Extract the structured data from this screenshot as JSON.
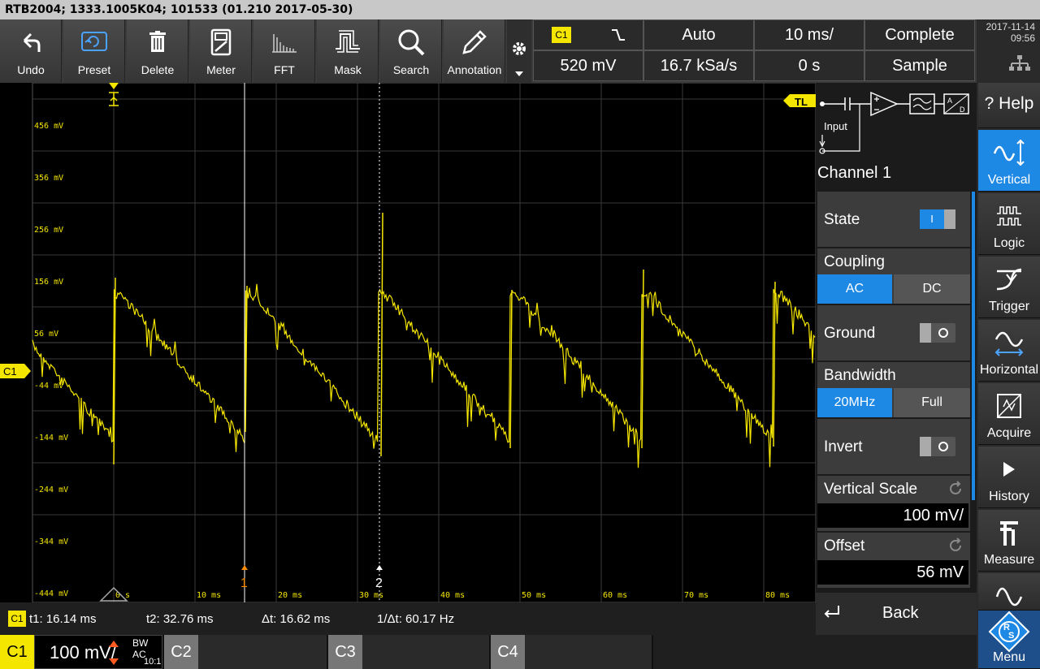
{
  "title": "RTB2004; 1333.1005K04; 101533 (01.210 2017-05-30)",
  "toolbar": [
    {
      "label": "Undo",
      "icon": "undo-icon"
    },
    {
      "label": "Preset",
      "icon": "preset-icon"
    },
    {
      "label": "Delete",
      "icon": "trash-icon"
    },
    {
      "label": "Meter",
      "icon": "meter-icon"
    },
    {
      "label": "FFT",
      "icon": "fft-icon"
    },
    {
      "label": "Mask",
      "icon": "mask-icon"
    },
    {
      "label": "Search",
      "icon": "search-icon"
    },
    {
      "label": "Annotation",
      "icon": "pencil-icon"
    }
  ],
  "status": {
    "trigger_source": "C1",
    "trigger_level": "520 mV",
    "trigger_mode": "Auto",
    "sample_rate": "16.7 kSa/s",
    "time_scale": "10 ms/",
    "time_offset": "0 s",
    "acq_state": "Complete",
    "acq_mode": "Sample"
  },
  "datetime": {
    "date": "2017-11-14",
    "time": "09:56"
  },
  "markers": {
    "trigger_level_label": "TL",
    "channel_label": "C1",
    "cursor1": "1",
    "cursor2": "2"
  },
  "y_ticks": [
    "456 mV",
    "356 mV",
    "256 mV",
    "156 mV",
    "56 mV",
    "-44 mV",
    "-144 mV",
    "-244 mV",
    "-344 mV",
    "-444 mV"
  ],
  "x_ticks": [
    "0 s",
    "10 ms",
    "20 ms",
    "30 ms",
    "40 ms",
    "50 ms",
    "60 ms",
    "70 ms",
    "80 ms"
  ],
  "cursors": {
    "channel": "C1",
    "t1": "t1: 16.14 ms",
    "t2": "t2: 32.76 ms",
    "dt": "Δt: 16.62 ms",
    "inv_dt": "1/Δt: 60.17 Hz"
  },
  "panel": {
    "block_input": "Input",
    "title": "Channel 1",
    "state_label": "State",
    "state_toggle": "I",
    "coupling_label": "Coupling",
    "coupling_ac": "AC",
    "coupling_dc": "DC",
    "ground_label": "Ground",
    "bandwidth_label": "Bandwidth",
    "bw_20": "20MHz",
    "bw_full": "Full",
    "invert_label": "Invert",
    "vscale_label": "Vertical Scale",
    "vscale_value": "100 mV/",
    "offset_label": "Offset",
    "offset_value": "56 mV",
    "back_label": "Back"
  },
  "sidebar": [
    {
      "label": "? Help",
      "icon": "help-icon"
    },
    {
      "label": "Vertical",
      "icon": "vertical-icon",
      "active": true
    },
    {
      "label": "Logic",
      "icon": "logic-icon"
    },
    {
      "label": "Trigger",
      "icon": "trigger-icon"
    },
    {
      "label": "Horizontal",
      "icon": "horizontal-icon"
    },
    {
      "label": "Acquire",
      "icon": "acquire-icon"
    },
    {
      "label": "History",
      "icon": "play-icon"
    },
    {
      "label": "Measure",
      "icon": "measure-icon"
    },
    {
      "label": "",
      "icon": "waveform-icon"
    },
    {
      "label": "Menu",
      "icon": "rs-logo-icon"
    }
  ],
  "channels": {
    "c1_label": "C1",
    "c1_scale": "100 mV/",
    "c1_bw": "BW AC",
    "c1_probe": "10:1",
    "c2_label": "C2",
    "c3_label": "C3",
    "c4_label": "C4"
  },
  "colors": {
    "ch1": "#f5e600",
    "accent": "#1e88e5",
    "cursor": "#ffffff",
    "cursor1_marker": "#ff8c00"
  }
}
